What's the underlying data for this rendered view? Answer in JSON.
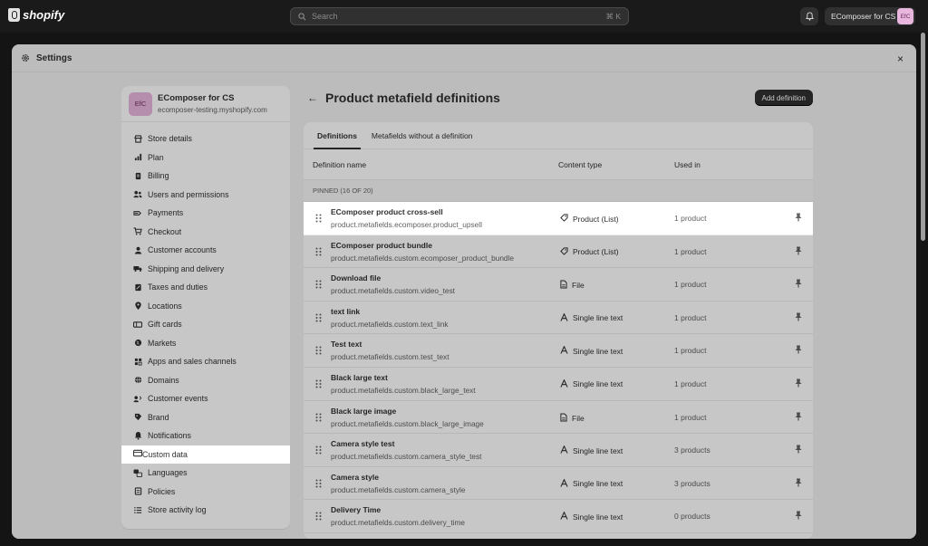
{
  "topbar": {
    "brand": "shopify",
    "search_placeholder": "Search",
    "search_shortcut": "⌘ K",
    "store_name": "EComposer for CS",
    "store_initials": "EfC"
  },
  "modal": {
    "title": "Settings",
    "close": "×"
  },
  "sidebar": {
    "store_initials": "EfC",
    "store_name": "EComposer for CS",
    "store_domain": "ecomposer-testing.myshopify.com",
    "items": [
      {
        "label": "Store details",
        "icon": "store-icon"
      },
      {
        "label": "Plan",
        "icon": "plan-icon"
      },
      {
        "label": "Billing",
        "icon": "billing-icon"
      },
      {
        "label": "Users and permissions",
        "icon": "users-icon"
      },
      {
        "label": "Payments",
        "icon": "payments-icon"
      },
      {
        "label": "Checkout",
        "icon": "cart-icon"
      },
      {
        "label": "Customer accounts",
        "icon": "person-icon"
      },
      {
        "label": "Shipping and delivery",
        "icon": "truck-icon"
      },
      {
        "label": "Taxes and duties",
        "icon": "tax-icon"
      },
      {
        "label": "Locations",
        "icon": "location-icon"
      },
      {
        "label": "Gift cards",
        "icon": "gift-card-icon"
      },
      {
        "label": "Markets",
        "icon": "globe-icon"
      },
      {
        "label": "Apps and sales channels",
        "icon": "apps-icon"
      },
      {
        "label": "Domains",
        "icon": "domain-icon"
      },
      {
        "label": "Customer events",
        "icon": "events-icon"
      },
      {
        "label": "Brand",
        "icon": "brand-icon"
      },
      {
        "label": "Notifications",
        "icon": "bell-icon"
      },
      {
        "label": "Custom data",
        "icon": "custom-data-icon"
      },
      {
        "label": "Languages",
        "icon": "languages-icon"
      },
      {
        "label": "Policies",
        "icon": "policies-icon"
      },
      {
        "label": "Store activity log",
        "icon": "activity-log-icon"
      }
    ],
    "active_index": 17
  },
  "main": {
    "title": "Product metafield definitions",
    "add_button": "Add definition",
    "tabs": [
      "Definitions",
      "Metafields without a definition"
    ],
    "columns": [
      "Definition name",
      "Content type",
      "Used in"
    ],
    "pinned_header": "PINNED (16 OF 20)",
    "rows": [
      {
        "name": "EComposer product cross-sell",
        "key": "product.metafields.ecomposer.product_upsell",
        "type": "Product (List)",
        "type_icon": "product-icon",
        "used": "1 product"
      },
      {
        "name": "EComposer product bundle",
        "key": "product.metafields.custom.ecomposer_product_bundle",
        "type": "Product (List)",
        "type_icon": "product-icon",
        "used": "1 product"
      },
      {
        "name": "Download file",
        "key": "product.metafields.custom.video_test",
        "type": "File",
        "type_icon": "file-icon",
        "used": "1 product"
      },
      {
        "name": "text link",
        "key": "product.metafields.custom.text_link",
        "type": "Single line text",
        "type_icon": "text-icon",
        "used": "1 product"
      },
      {
        "name": "Test text",
        "key": "product.metafields.custom.test_text",
        "type": "Single line text",
        "type_icon": "text-icon",
        "used": "1 product"
      },
      {
        "name": "Black large text",
        "key": "product.metafields.custom.black_large_text",
        "type": "Single line text",
        "type_icon": "text-icon",
        "used": "1 product"
      },
      {
        "name": "Black large image",
        "key": "product.metafields.custom.black_large_image",
        "type": "File",
        "type_icon": "file-icon",
        "used": "1 product"
      },
      {
        "name": "Camera style test",
        "key": "product.metafields.custom.camera_style_test",
        "type": "Single line text",
        "type_icon": "text-icon",
        "used": "3 products"
      },
      {
        "name": "Camera style",
        "key": "product.metafields.custom.camera_style",
        "type": "Single line text",
        "type_icon": "text-icon",
        "used": "3 products"
      },
      {
        "name": "Delivery Time",
        "key": "product.metafields.custom.delivery_time",
        "type": "Single line text",
        "type_icon": "text-icon",
        "used": "0 products"
      }
    ]
  }
}
